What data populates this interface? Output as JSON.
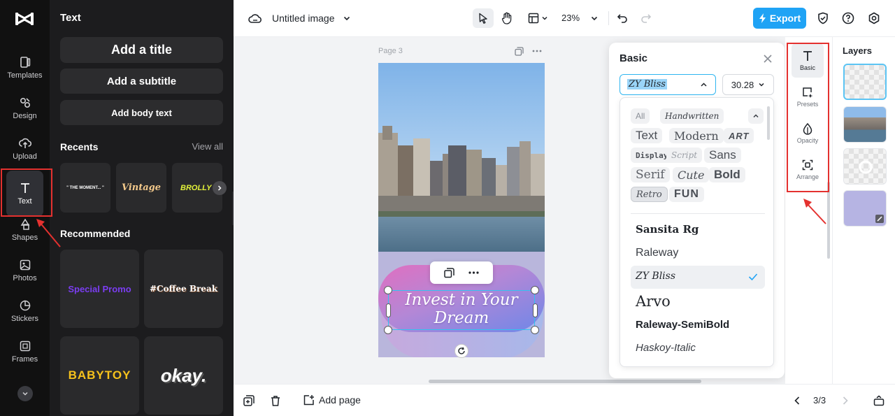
{
  "rail": {
    "items": [
      {
        "label": "Templates",
        "icon": "templates-icon"
      },
      {
        "label": "Design",
        "icon": "design-icon"
      },
      {
        "label": "Upload",
        "icon": "upload-icon"
      },
      {
        "label": "Text",
        "icon": "text-icon"
      },
      {
        "label": "Shapes",
        "icon": "shapes-icon"
      },
      {
        "label": "Photos",
        "icon": "photos-icon"
      },
      {
        "label": "Stickers",
        "icon": "stickers-icon"
      },
      {
        "label": "Frames",
        "icon": "frames-icon"
      }
    ]
  },
  "panel": {
    "title": "Text",
    "add_title": "Add a title",
    "add_subtitle": "Add a subtitle",
    "add_body": "Add body text",
    "recents_title": "Recents",
    "view_all": "View all",
    "recents": [
      "\" THE MOMENT... \"",
      "Vintage",
      "BROLLY HOLIDAY"
    ],
    "recommended_title": "Recommended",
    "recommended": [
      "Special Promo",
      "#Coffee Break",
      "BABYTOY",
      "okay."
    ]
  },
  "header": {
    "doc_title": "Untitled image",
    "zoom": "23%",
    "export_label": "Export"
  },
  "canvas": {
    "page_label": "Page 3",
    "text_content_line1": "Invest in Your",
    "text_content_line2": "Dream"
  },
  "basic_panel": {
    "title": "Basic",
    "font_value": "ZY Bliss",
    "size_value": "30.28",
    "categories": [
      "All",
      "Handwritten",
      "Text",
      "Modern",
      "ART",
      "Display",
      "Script",
      "Sans",
      "Serif",
      "Cute",
      "Bold",
      "Retro",
      "FUN"
    ],
    "fonts": [
      "Sansita Rg",
      "Raleway",
      "ZY Bliss",
      "Arvo",
      "Raleway-SemiBold",
      "Haskoy-Italic"
    ]
  },
  "props": {
    "items": [
      "Basic",
      "Presets",
      "Opacity",
      "Arrange"
    ]
  },
  "layers": {
    "title": "Layers"
  },
  "footer": {
    "add_page": "Add page",
    "page_count": "3/3"
  },
  "colors": {
    "accent": "#1fa3f5",
    "annotation": "#e4312f",
    "rail_bg": "#111111",
    "panel_bg": "#1c1c1e"
  }
}
